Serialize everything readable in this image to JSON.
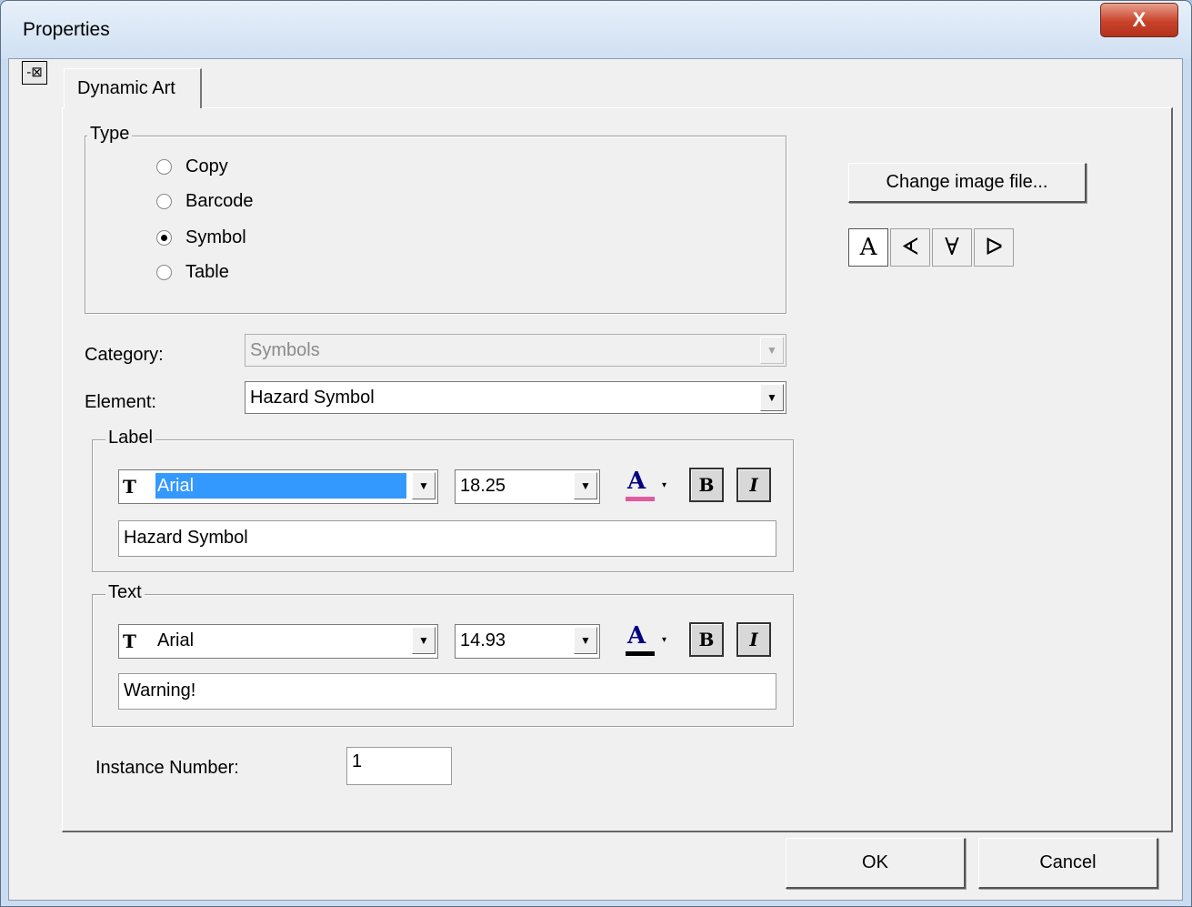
{
  "window": {
    "title": "Properties",
    "close_glyph": "X"
  },
  "tab": {
    "label": "Dynamic Art"
  },
  "type_group": {
    "legend": "Type",
    "options": [
      {
        "label": "Copy",
        "selected": false
      },
      {
        "label": "Barcode",
        "selected": false
      },
      {
        "label": "Symbol",
        "selected": true
      },
      {
        "label": "Table",
        "selected": false
      }
    ]
  },
  "category": {
    "label": "Category:",
    "value": "Symbols",
    "disabled": true
  },
  "element": {
    "label": "Element:",
    "value": "Hazard Symbol"
  },
  "label_group": {
    "legend": "Label",
    "font": "Arial",
    "size": "18.25",
    "color_bar": "#e05aa0",
    "bold": "B",
    "italic": "I",
    "text": "Hazard Symbol"
  },
  "text_group": {
    "legend": "Text",
    "font": "Arial",
    "size": "14.93",
    "color_bar": "#000000",
    "bold": "B",
    "italic": "I",
    "text": "Warning!"
  },
  "instance": {
    "label": "Instance Number:",
    "value": "1"
  },
  "change_image": {
    "label": "Change image file..."
  },
  "orientation": [
    "A",
    "ᗉ",
    "∀",
    "ᐅ"
  ],
  "buttons": {
    "ok": "OK",
    "cancel": "Cancel"
  },
  "glyphs": {
    "pin": "-⊠",
    "font_type": "T",
    "dropdown": "▼",
    "small_dropdown": "▾",
    "color_letter": "A"
  }
}
